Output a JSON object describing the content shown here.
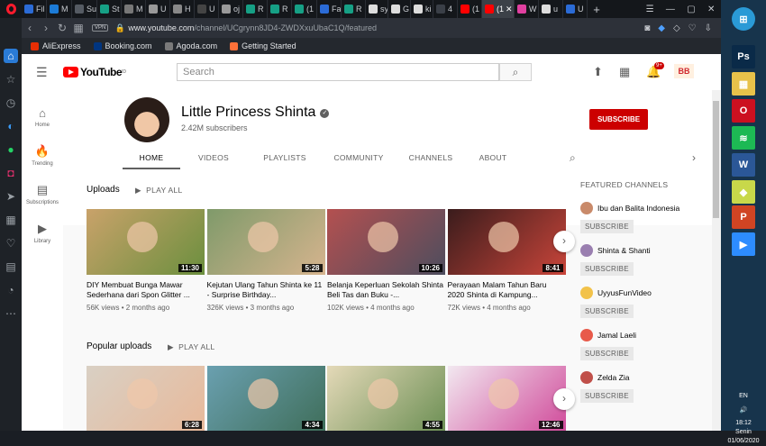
{
  "tabs": [
    {
      "label": "Fil",
      "color": "#2b6bd6"
    },
    {
      "label": "M",
      "color": "#1c7bd6"
    },
    {
      "label": "Su",
      "color": "#555b63"
    },
    {
      "label": "St",
      "color": "#16a085"
    },
    {
      "label": "M",
      "color": "#777"
    },
    {
      "label": "U",
      "color": "#999"
    },
    {
      "label": "H",
      "color": "#888"
    },
    {
      "label": "U",
      "color": "#444"
    },
    {
      "label": "oj",
      "color": "#999"
    },
    {
      "label": "R",
      "color": "#16a085"
    },
    {
      "label": "R",
      "color": "#16a085"
    },
    {
      "label": "(1",
      "color": "#16a085"
    },
    {
      "label": "Fa",
      "color": "#2b6bd6"
    },
    {
      "label": "R",
      "color": "#16a085"
    },
    {
      "label": "sy",
      "color": "#ddd"
    },
    {
      "label": "G",
      "color": "#ddd"
    },
    {
      "label": "ki",
      "color": "#ddd"
    },
    {
      "label": "4",
      "color": "#3a3f47"
    },
    {
      "label": "(1",
      "color": "#ff0000"
    },
    {
      "label": "(1",
      "color": "#ff0000",
      "active": true
    },
    {
      "label": "W",
      "color": "#e040a0"
    },
    {
      "label": "u",
      "color": "#ddd"
    },
    {
      "label": "U",
      "color": "#2b6bd6"
    }
  ],
  "new_tab": "+",
  "address": {
    "domain": "www.youtube.com",
    "path": "/channel/UCgrynn8JD4-ZWDXxuUbaC1Q/featured",
    "vpn": "VPN"
  },
  "bookmarks": [
    {
      "label": "AliExpress",
      "color": "#e62e04"
    },
    {
      "label": "Booking.com",
      "color": "#003580"
    },
    {
      "label": "Agoda.com",
      "color": "#7a7a7a"
    },
    {
      "label": "Getting Started",
      "color": "#ff7139"
    }
  ],
  "youtube": {
    "logo": "YouTube",
    "logo_region": "ID",
    "search_placeholder": "Search",
    "notif_count": "9+",
    "account_label": "BB"
  },
  "guide": [
    {
      "label": "Home",
      "icon": "home-icon",
      "glyph": "⌂"
    },
    {
      "label": "Trending",
      "icon": "flame-icon",
      "glyph": "🔥"
    },
    {
      "label": "Subscriptions",
      "icon": "subscriptions-icon",
      "glyph": "▤"
    },
    {
      "label": "Library",
      "icon": "library-icon",
      "glyph": "▶"
    }
  ],
  "channel": {
    "name": "Little Princess Shinta",
    "subscribers": "2.42M subscribers",
    "subscribe_label": "SUBSCRIBE",
    "tabs": [
      "HOME",
      "VIDEOS",
      "PLAYLISTS",
      "COMMUNITY",
      "CHANNELS",
      "ABOUT"
    ],
    "active_tab": "HOME"
  },
  "uploads": {
    "title": "Uploads",
    "play_all": "PLAY ALL",
    "videos": [
      {
        "title": "DIY Membuat Bunga Mawar Sederhana dari Spon Glitter ...",
        "views": "56K views",
        "age": "2 months ago",
        "duration": "11:30",
        "c1": "#c9a26a",
        "c2": "#6b8f3e"
      },
      {
        "title": "Kejutan Ulang Tahun Shinta ke 11 - Surprise Birthday...",
        "views": "326K views",
        "age": "3 months ago",
        "duration": "5:28",
        "c1": "#7f9a6a",
        "c2": "#d6b48e"
      },
      {
        "title": "Belanja Keperluan Sekolah Shinta Beli Tas dan Buku -...",
        "views": "102K views",
        "age": "4 months ago",
        "duration": "10:26",
        "c1": "#b45050",
        "c2": "#4d4d5e"
      },
      {
        "title": "Perayaan Malam Tahun Baru 2020 Shinta di Kampung...",
        "views": "72K views",
        "age": "4 months ago",
        "duration": "8:41",
        "c1": "#3a1c1c",
        "c2": "#c9453a"
      }
    ]
  },
  "popular": {
    "title": "Popular uploads",
    "play_all": "PLAY ALL",
    "videos": [
      {
        "duration": "6:28",
        "c1": "#d9d0c4",
        "c2": "#e8b99a"
      },
      {
        "duration": "4:34",
        "c1": "#6aa0b0",
        "c2": "#3f6e5a"
      },
      {
        "duration": "4:55",
        "c1": "#e4d9b8",
        "c2": "#6c8f54"
      },
      {
        "duration": "12:46",
        "c1": "#f2e8f0",
        "c2": "#d04a9a"
      }
    ]
  },
  "featured": {
    "title": "FEATURED CHANNELS",
    "subscribe_label": "SUBSCRIBE",
    "channels": [
      {
        "name": "Ibu dan Balita Indonesia",
        "color": "#c98a6a"
      },
      {
        "name": "Shinta & Shanti",
        "color": "#9a7fb0"
      },
      {
        "name": "UyyusFunVideo",
        "color": "#f2c24a"
      },
      {
        "name": "Jamal Laeli",
        "color": "#e85a4a"
      },
      {
        "name": "Zelda Zia",
        "color": "#c0504a"
      }
    ]
  },
  "taskbar": {
    "apps": [
      {
        "label": "⊞",
        "name": "start-button",
        "color": "#2a9ad6"
      },
      {
        "label": "Ps",
        "name": "photoshop-app",
        "color": "#0a2a48"
      },
      {
        "label": "▦",
        "name": "file-explorer-app",
        "color": "#e8c24a"
      },
      {
        "label": "O",
        "name": "opera-app",
        "color": "#cc1020"
      },
      {
        "label": "≋",
        "name": "spotify-app",
        "color": "#1db954"
      },
      {
        "label": "W",
        "name": "word-app",
        "color": "#2b5797"
      },
      {
        "label": "◆",
        "name": "stickies-app",
        "color": "#c8d84a"
      },
      {
        "label": "P",
        "name": "powerpoint-app",
        "color": "#d04423"
      },
      {
        "label": "▶",
        "name": "zoom-app",
        "color": "#2d8cff"
      }
    ],
    "lang": "EN",
    "time": "18:12",
    "day": "Senin",
    "date": "01/06/2020"
  }
}
